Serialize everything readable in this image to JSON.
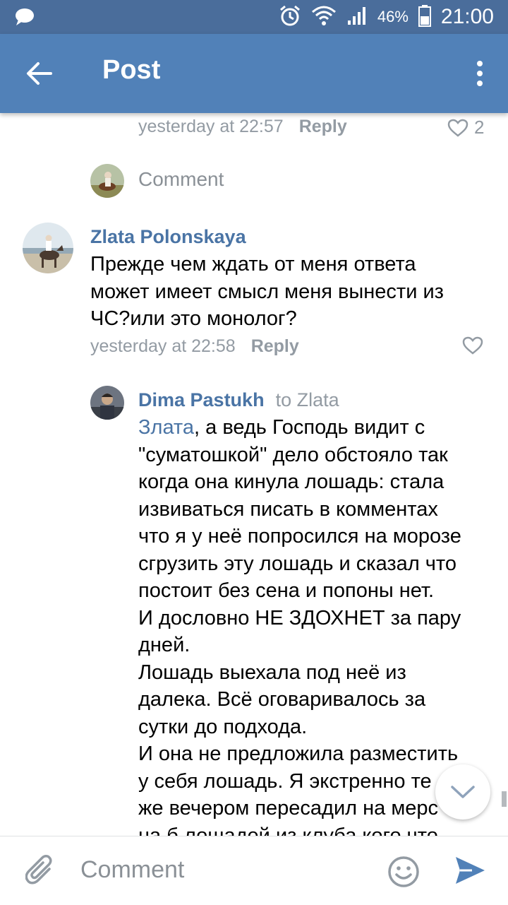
{
  "status_bar": {
    "battery": "46%",
    "time": "21:00"
  },
  "toolbar": {
    "title": "Post"
  },
  "prev_comment": {
    "timestamp": "yesterday at 22:57",
    "reply_label": "Reply",
    "likes": "2"
  },
  "comment_box": {
    "placeholder": "Comment"
  },
  "comments": [
    {
      "author": "Zlata Polonskaya",
      "lines": [
        "Прежде чем ждать от меня ответа",
        "может имеет смысл меня вынести из",
        "ЧС?или это монолог?"
      ],
      "timestamp": "yesterday at 22:58",
      "reply_label": "Reply"
    },
    {
      "author": "Dima Pastukh",
      "to": "to Zlata",
      "mention": "Злата",
      "first_line_rest": ", а ведь Господь видит с",
      "lines": [
        "\"суматошкой\" дело обстояло так",
        "когда она кинула лошадь: стала",
        "извиваться писать в комментах",
        "что я у неё попросился на морозе",
        "сгрузить эту лошадь и сказал что",
        "постоит без сена и попоны нет.",
        "И дословно НЕ ЗДОХНЕТ за пару",
        "дней.",
        "Лошадь выехала под неё из",
        "далека. Всё оговаривалось за",
        "сутки до подхода.",
        "И она не предложила разместить",
        "у себя лошадь. Я экстренно те",
        "же вечером пересадил на мерс",
        "на б лошадей из клуба кого что"
      ]
    }
  ],
  "bottom_bar": {
    "placeholder": "Comment"
  },
  "colors": {
    "status_bar": "#4a6d9b",
    "toolbar": "#5181b8",
    "link": "#4a74a5",
    "meta": "#939ba3",
    "send": "#5181b8"
  }
}
